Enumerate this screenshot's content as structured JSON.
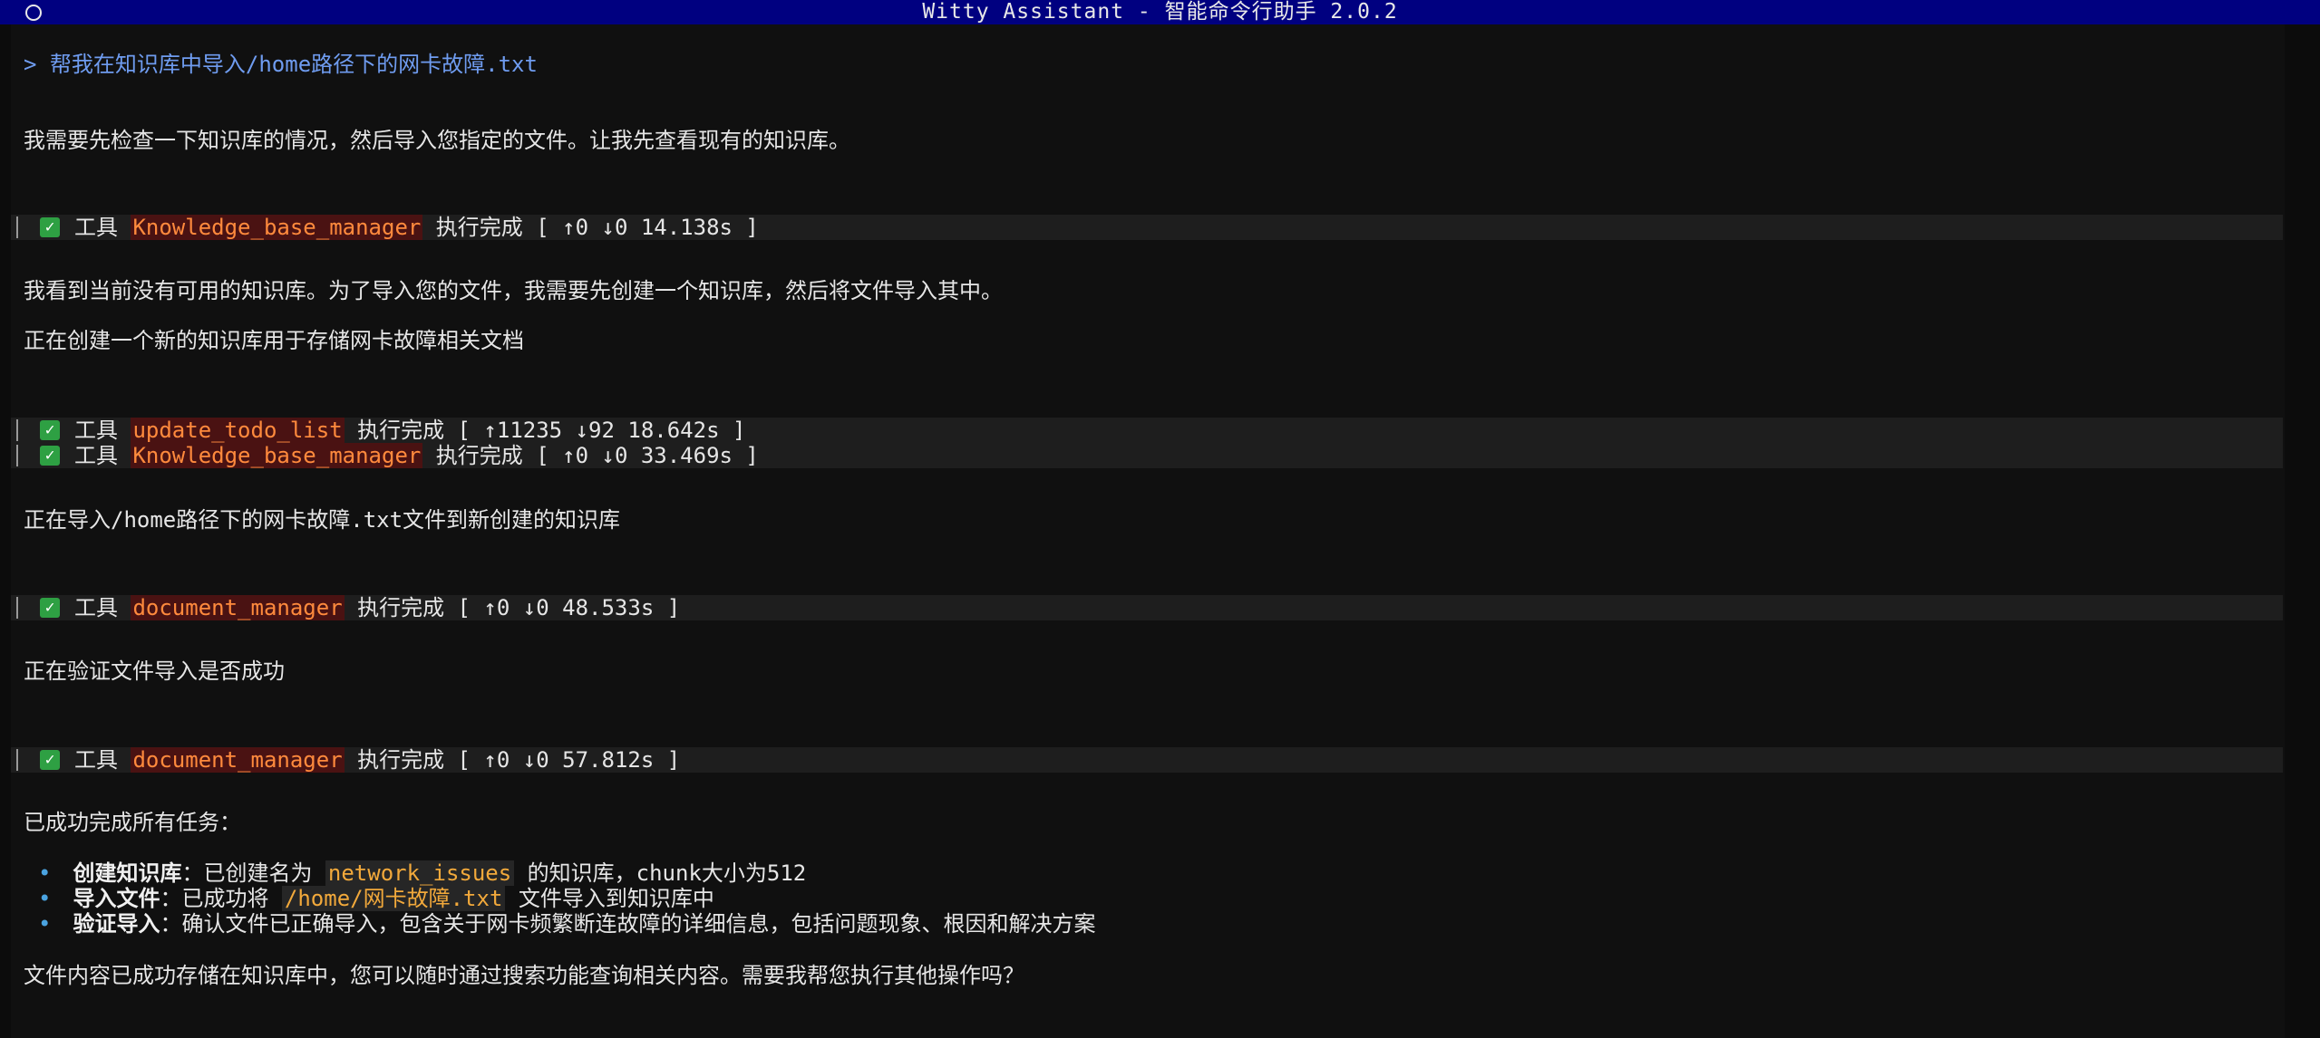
{
  "window": {
    "title": "Witty Assistant - 智能命令行助手 2.0.2"
  },
  "prompt": "> 帮我在知识库中导入/home路径下的网卡故障.txt",
  "messages": {
    "m1": "我需要先检查一下知识库的情况，然后导入您指定的文件。让我先查看现有的知识库。",
    "m2": "我看到当前没有可用的知识库。为了导入您的文件，我需要先创建一个知识库，然后将文件导入其中。",
    "m3": "正在创建一个新的知识库用于存储网卡故障相关文档",
    "m4": "正在导入/home路径下的网卡故障.txt文件到新创建的知识库",
    "m5": "正在验证文件导入是否成功",
    "m6": "已成功完成所有任务：",
    "m7": "文件内容已成功存储在知识库中，您可以随时通过搜索功能查询相关内容。需要我帮您执行其他操作吗？"
  },
  "tools": [
    {
      "prefix": "工具",
      "name": "Knowledge_base_manager",
      "status": "执行完成 [ ↑0 ↓0 14.138s ]"
    },
    {
      "prefix": "工具",
      "name": "update_todo_list",
      "status": "执行完成 [ ↑11235 ↓92 18.642s ]"
    },
    {
      "prefix": "工具",
      "name": "Knowledge_base_manager",
      "status": "执行完成 [ ↑0 ↓0 33.469s ]"
    },
    {
      "prefix": "工具",
      "name": "document_manager",
      "status": "执行完成 [ ↑0 ↓0 48.533s ]"
    },
    {
      "prefix": "工具",
      "name": "document_manager",
      "status": "执行完成 [ ↑0 ↓0 57.812s ]"
    }
  ],
  "summary": [
    {
      "bullet": "•",
      "label": "创建知识库",
      "pre": "：已创建名为 ",
      "code": "network_issues",
      "post": " 的知识库，chunk大小为512"
    },
    {
      "bullet": "•",
      "label": "导入文件",
      "pre": "：已成功将 ",
      "code": "/home/网卡故障.txt",
      "post": " 文件导入到知识库中"
    },
    {
      "bullet": "•",
      "label": "验证导入",
      "pre": "：确认文件已正确导入，包含关于网卡频繁断连故障的详细信息，包括问题现象、根因和解决方案",
      "code": "",
      "post": ""
    }
  ],
  "colors": {
    "titlebar": "#000080",
    "prompt": "#6f9cf0",
    "tool_name": "#ff8a3d",
    "check": "#2ea043",
    "code": "#f2a93b"
  }
}
